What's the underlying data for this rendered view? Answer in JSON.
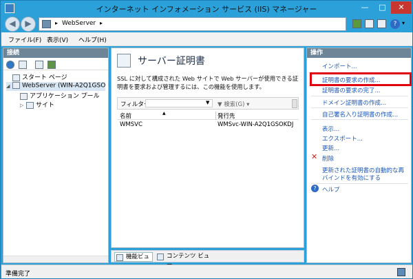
{
  "window": {
    "title": "インターネット インフォメーション サービス (IIS) マネージャー",
    "minimize": "—",
    "maximize": "□",
    "close": "✕"
  },
  "address": {
    "back": "◀",
    "forward": "▶",
    "sep": "▸",
    "path": "WebServer"
  },
  "menu": {
    "file": "ファイル(F)",
    "view": "表示(V)",
    "help": "ヘルプ(H)"
  },
  "connections": {
    "header": "接続",
    "tree": [
      {
        "label": "スタート ページ"
      },
      {
        "label": "WebServer (WIN-A2Q1GSO"
      },
      {
        "label": "アプリケーション プール"
      },
      {
        "label": "サイト"
      }
    ]
  },
  "center": {
    "title": "サーバー証明書",
    "description": "SSL に対して構成された Web サイトで Web サーバーが使用できる証明書を要求および管理するには、この機能を使用します。",
    "filter_label": "フィルター:",
    "filter_go": "▼ 検索(G) ▾",
    "columns": [
      "名前",
      "発行先"
    ],
    "rows": [
      {
        "name": "WMSVC",
        "issued_to": "WMSvc-WIN-A2Q1GSOKDJ"
      }
    ],
    "tabs": [
      "機能ビュー",
      "コンテンツ ビュー"
    ]
  },
  "actions": {
    "header": "操作",
    "items": [
      "インポート...",
      "証明書の要求の作成...",
      "証明書の要求の完了...",
      "ドメイン証明書の作成...",
      "自己署名入り証明書の作成...",
      "表示...",
      "エクスポート...",
      "更新...",
      "削除",
      "更新された証明書の自動的な再",
      "バインドを有効にする",
      "ヘルプ"
    ],
    "highlight_color": "#e2000f"
  },
  "status": {
    "text": "準備完了"
  }
}
